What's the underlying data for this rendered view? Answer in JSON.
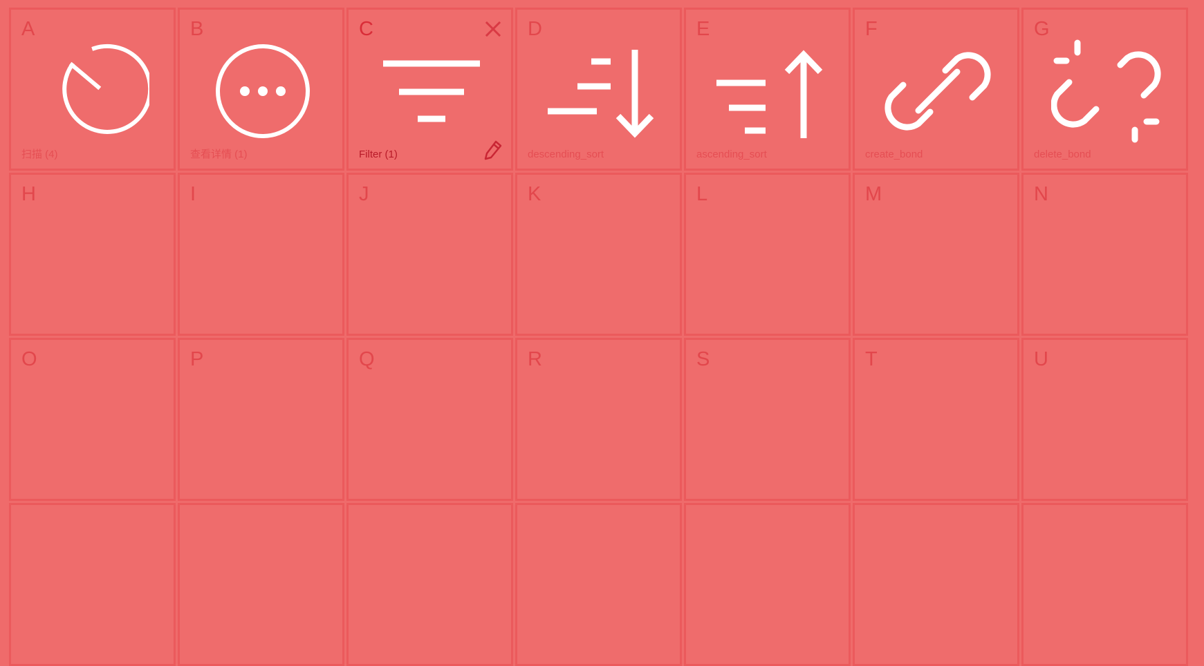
{
  "colors": {
    "background": "#ef6b6b",
    "cell_border": "#eb5a5c",
    "icon_stroke": "#ffffff",
    "muted_text": "#e54e53",
    "active_text": "#b81a28"
  },
  "cells": [
    {
      "letter": "A",
      "caption": "扫描 (4)",
      "icon": "timer-icon"
    },
    {
      "letter": "B",
      "caption": "查看详情 (1)",
      "icon": "more-circle-icon"
    },
    {
      "letter": "C",
      "caption": "Filter (1)",
      "icon": "filter-icon",
      "active": true
    },
    {
      "letter": "D",
      "caption": "descending_sort",
      "icon": "sort-descending-icon"
    },
    {
      "letter": "E",
      "caption": "ascending_sort",
      "icon": "sort-ascending-icon"
    },
    {
      "letter": "F",
      "caption": "create_bond",
      "icon": "link-icon"
    },
    {
      "letter": "G",
      "caption": "delete_bond",
      "icon": "unlink-icon"
    },
    {
      "letter": "H"
    },
    {
      "letter": "I"
    },
    {
      "letter": "J"
    },
    {
      "letter": "K"
    },
    {
      "letter": "L"
    },
    {
      "letter": "M"
    },
    {
      "letter": "N"
    },
    {
      "letter": "O"
    },
    {
      "letter": "P"
    },
    {
      "letter": "Q"
    },
    {
      "letter": "R"
    },
    {
      "letter": "S"
    },
    {
      "letter": "T"
    },
    {
      "letter": "U"
    },
    {
      "letter": ""
    },
    {
      "letter": ""
    },
    {
      "letter": ""
    },
    {
      "letter": ""
    },
    {
      "letter": ""
    },
    {
      "letter": ""
    },
    {
      "letter": ""
    }
  ]
}
